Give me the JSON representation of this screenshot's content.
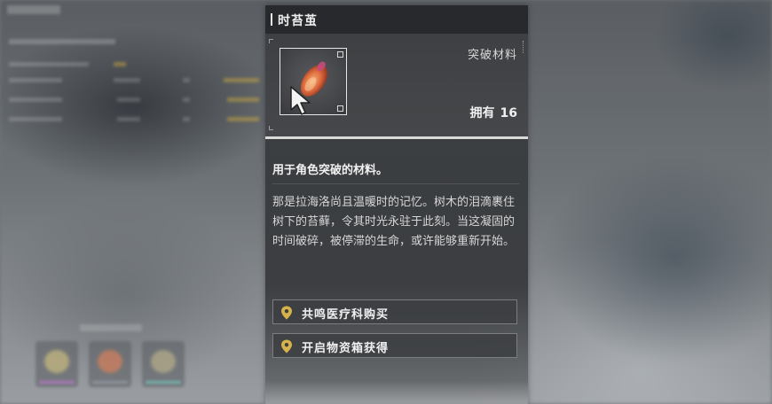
{
  "tooltip": {
    "title": "时苔茧",
    "category": "突破材料",
    "owned_label": "拥有",
    "owned_count": "16",
    "short_description": "用于角色突破的材料。",
    "lore": "那是拉海洛尚且温暖时的记忆。树木的泪滴裹住树下的苔藓，令其时光永驻于此刻。当这凝固的时间破碎，被停滞的生命，或许能够重新开始。",
    "sources": [
      {
        "label": "共鸣医疗科购买",
        "icon": "location-pin-icon"
      },
      {
        "label": "开启物资箱获得",
        "icon": "location-pin-icon"
      }
    ],
    "item_icon": "amber-cocoon-icon"
  },
  "colors": {
    "pin": "#d7b24a",
    "item_glow": "#e0804a",
    "accent_bar": "#d9d9d9"
  }
}
